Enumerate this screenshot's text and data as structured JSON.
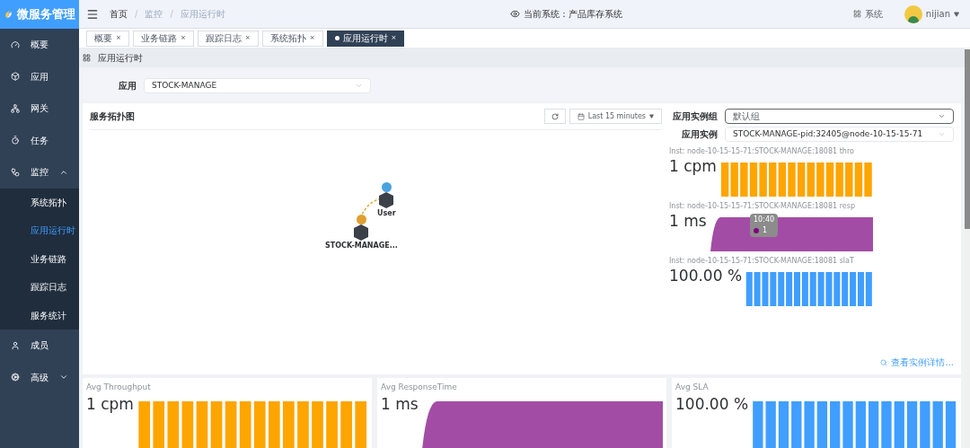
{
  "sidebar": {
    "logo": "微服务管理",
    "items": [
      {
        "label": "概要",
        "selected": false
      },
      {
        "label": "应用",
        "selected": false
      },
      {
        "label": "网关",
        "selected": false
      },
      {
        "label": "任务",
        "selected": false
      },
      {
        "label": "监控",
        "selected": false,
        "expanded": true,
        "children": [
          {
            "label": "系统拓扑",
            "selected": false
          },
          {
            "label": "应用运行时",
            "selected": true
          },
          {
            "label": "业务链路",
            "selected": false
          },
          {
            "label": "跟踪日志",
            "selected": false
          },
          {
            "label": "服务统计",
            "selected": false
          }
        ]
      },
      {
        "label": "成员",
        "selected": false
      },
      {
        "label": "高级",
        "selected": false,
        "expanded": false
      }
    ]
  },
  "header": {
    "breadcrumb": [
      "首页",
      "监控",
      "应用运行时"
    ],
    "separator": "/",
    "current_system": "当前系统：产品库存系统",
    "system_link": "系统",
    "user": "nijian"
  },
  "tabs": [
    {
      "label": "概要",
      "selected": false,
      "close": "×"
    },
    {
      "label": "业务链路",
      "selected": false,
      "close": "×"
    },
    {
      "label": "跟踪日志",
      "selected": false,
      "close": "×"
    },
    {
      "label": "系统拓扑",
      "selected": false,
      "close": "×"
    },
    {
      "label": "应用运行时",
      "selected": true,
      "close": "×"
    }
  ],
  "page_title": "应用运行时",
  "app_select": {
    "label": "应用",
    "value": "STOCK-MANAGE"
  },
  "topology": {
    "title": "服务拓扑图",
    "time_range": "Last 15 minutes",
    "nodes": [
      {
        "label": "User",
        "color": "#4aa3df"
      },
      {
        "label": "STOCK-MANAGE...",
        "color": "#e0a030"
      }
    ]
  },
  "instance_panel": {
    "group_label": "应用实例组",
    "group_value": "默认组",
    "instance_label": "应用实例",
    "instance_value": "STOCK-MANAGE-pid:32405@node-10-15-15-71",
    "metrics": [
      {
        "kind": "bar",
        "title": "Inst: node-10-15-15-71:STOCK-MANAGE:18081 thro",
        "value": "1 cpm",
        "color": "#ffa500"
      },
      {
        "kind": "area",
        "title": "Inst: node-10-15-15-71:STOCK-MANAGE:18081 resp",
        "value": "1 ms",
        "color": "#a34ca5",
        "tooltip": {
          "time": "10:40",
          "value": "1"
        }
      },
      {
        "kind": "bar",
        "title": "Inst: node-10-15-15-71:STOCK-MANAGE:18081 slaT",
        "value": "100.00 %",
        "color": "#409eff"
      }
    ],
    "details_link": "查看实例详情..."
  },
  "summary": [
    {
      "kind": "bar",
      "title": "Avg Throughput",
      "value": "1 cpm",
      "color": "#ffa500"
    },
    {
      "kind": "area",
      "title": "Avg ResponseTime",
      "value": "1 ms",
      "color": "#a34ca5"
    },
    {
      "kind": "bar",
      "title": "Avg SLA",
      "value": "100.00 %",
      "color": "#409eff"
    }
  ]
}
